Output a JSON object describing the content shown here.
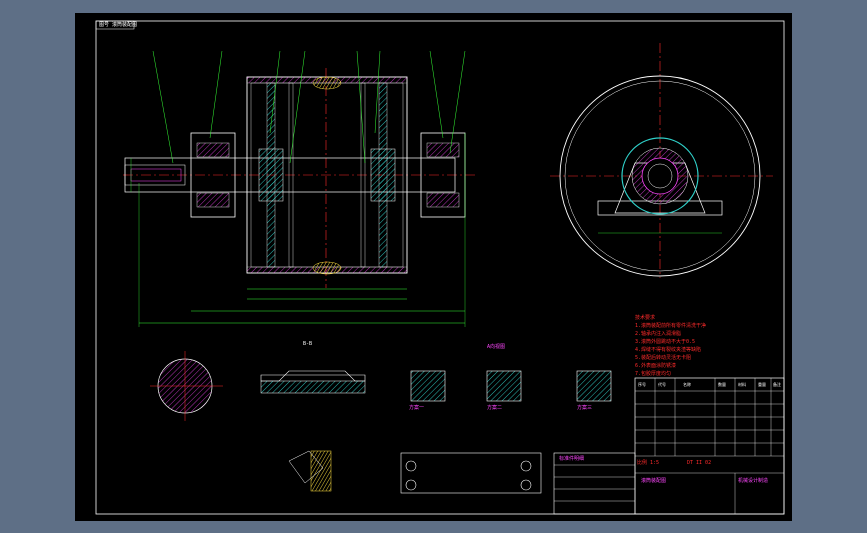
{
  "drawing": {
    "corner_tag": "图号 滚筒装配图",
    "tech_notes_title": "技术要求",
    "tech_notes": [
      "1.滚筒装配前所有零件清洗干净",
      "2.轴承内注入润滑脂",
      "3.滚筒外圆跳动不大于0.5",
      "4.焊缝不得有裂纹夹渣等缺陷",
      "5.装配后转动灵活无卡阻",
      "6.外表面涂防锈漆",
      "7.包胶厚度均匀"
    ],
    "detail_label_1": "B-B",
    "detail_label_2": "A向视图",
    "view_labels": [
      "方案一",
      "方案二",
      "方案三"
    ],
    "scale_text": "比例 1:5",
    "drawing_number": "DT II 02",
    "title": "滚筒装配图",
    "company": "机械设计制造",
    "left_block_title": "标准件明细",
    "bom_header": [
      "序号",
      "代号",
      "名称",
      "数量",
      "材料",
      "重量",
      "备注"
    ]
  },
  "colors": {
    "background": "#000000",
    "frame": "#ffffff",
    "outline": "#ffffff",
    "centerline": "#ff2b2b",
    "dimension": "#35ff35",
    "hatch": "#ff47ff",
    "highlight": "#ffff40",
    "ui": "#5e6f86"
  }
}
